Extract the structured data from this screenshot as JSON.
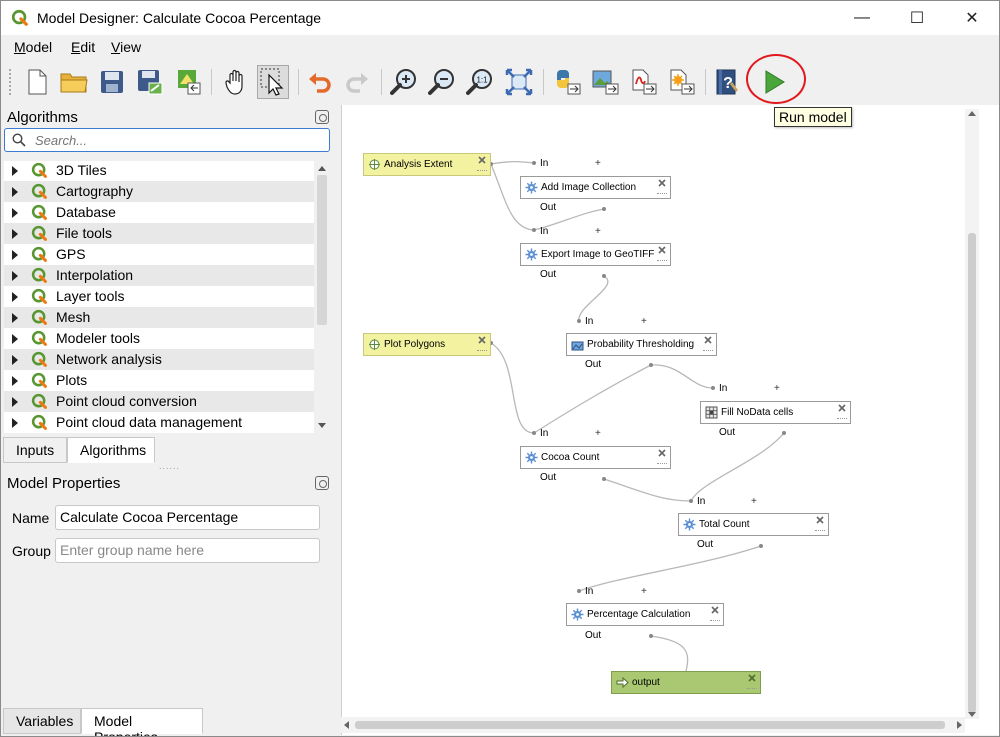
{
  "window": {
    "title": "Model Designer: Calculate Cocoa Percentage",
    "minimize_glyph": "—",
    "maximize_glyph": "☐",
    "close_glyph": "✕"
  },
  "menu": [
    {
      "label_u": "M",
      "label_rest": "odel"
    },
    {
      "label_u": "E",
      "label_rest": "dit"
    },
    {
      "label_u": "V",
      "label_rest": "iew"
    }
  ],
  "toolbar": {
    "tooltip": "Run model",
    "buttons": [
      "new-model-icon",
      "open-model-icon",
      "save-model-icon",
      "save-as-icon",
      "save-to-project-icon",
      "pan-icon",
      "select-icon",
      "undo-icon",
      "redo-icon",
      "zoom-in-icon",
      "zoom-out-icon",
      "zoom-actual-icon",
      "zoom-full-icon",
      "export-python-icon",
      "export-image-icon",
      "export-pdf-icon",
      "export-svg-icon",
      "edit-help-icon",
      "run-model-icon"
    ],
    "accent_color": "#e0191f"
  },
  "algorithms_panel": {
    "title": "Algorithms",
    "search_placeholder": "Search...",
    "items": [
      "3D Tiles",
      "Cartography",
      "Database",
      "File tools",
      "GPS",
      "Interpolation",
      "Layer tools",
      "Mesh",
      "Modeler tools",
      "Network analysis",
      "Plots",
      "Point cloud conversion",
      "Point cloud data management"
    ]
  },
  "tabs_top": [
    "Inputs",
    "Algorithms"
  ],
  "model_properties": {
    "title": "Model Properties",
    "name_label": "Name",
    "name_value": "Calculate Cocoa Percentage",
    "group_label": "Group",
    "group_placeholder": "Enter group name here"
  },
  "tabs_bottom": [
    "Variables",
    "Model Properties"
  ],
  "model": {
    "inputs": [
      "Analysis Extent",
      "Plot Polygons"
    ],
    "algorithms": [
      "Add Image Collection",
      "Export Image to GeoTIFF",
      "Probability Thresholding",
      "Fill NoData cells",
      "Cocoa Count",
      "Total Count",
      "Percentage Calculation"
    ],
    "output": "output",
    "port_in": "In",
    "port_out": "Out",
    "plus": "+",
    "colors": {
      "input": "#f2f2a0",
      "output": "#aac872",
      "algorithm": "#ffffff"
    }
  }
}
